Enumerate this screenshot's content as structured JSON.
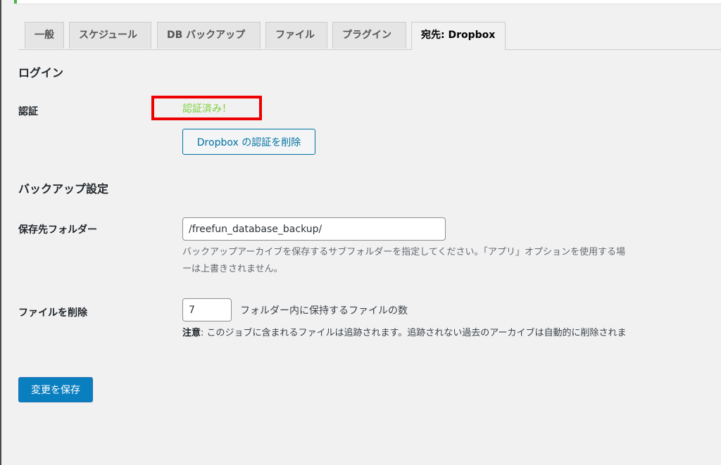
{
  "tabs": [
    {
      "label": "一般"
    },
    {
      "label": "スケジュール"
    },
    {
      "label": "DB バックアップ"
    },
    {
      "label": "ファイル"
    },
    {
      "label": "プラグイン"
    },
    {
      "label": "宛先: Dropbox"
    }
  ],
  "login": {
    "title": "ログイン",
    "auth_label": "認証",
    "auth_status": "認証済み！",
    "remove_auth_button": "Dropbox の認証を削除"
  },
  "backup": {
    "title": "バックアップ設定",
    "folder_label": "保存先フォルダー",
    "folder_value": "/freefun_database_backup/",
    "folder_desc_line1": "バックアップアーカイブを保存するサブフォルダーを指定してください。「アプリ」オプションを使用する場",
    "folder_desc_line2": "ーは上書きされません。",
    "delete_label": "ファイルを削除",
    "delete_value": "7",
    "delete_suffix": "フォルダー内に保持するファイルの数",
    "note_prefix": "注意",
    "note_text": ": このジョブに含まれるファイルは追跡されます。追跡されない過去のアーカイブは自動的に削除されま"
  },
  "save_button": "変更を保存",
  "colors": {
    "status_ok": "#7ad03a",
    "highlight_box": "#ee0000",
    "primary": "#0a7fc0",
    "link": "#0071a1"
  }
}
